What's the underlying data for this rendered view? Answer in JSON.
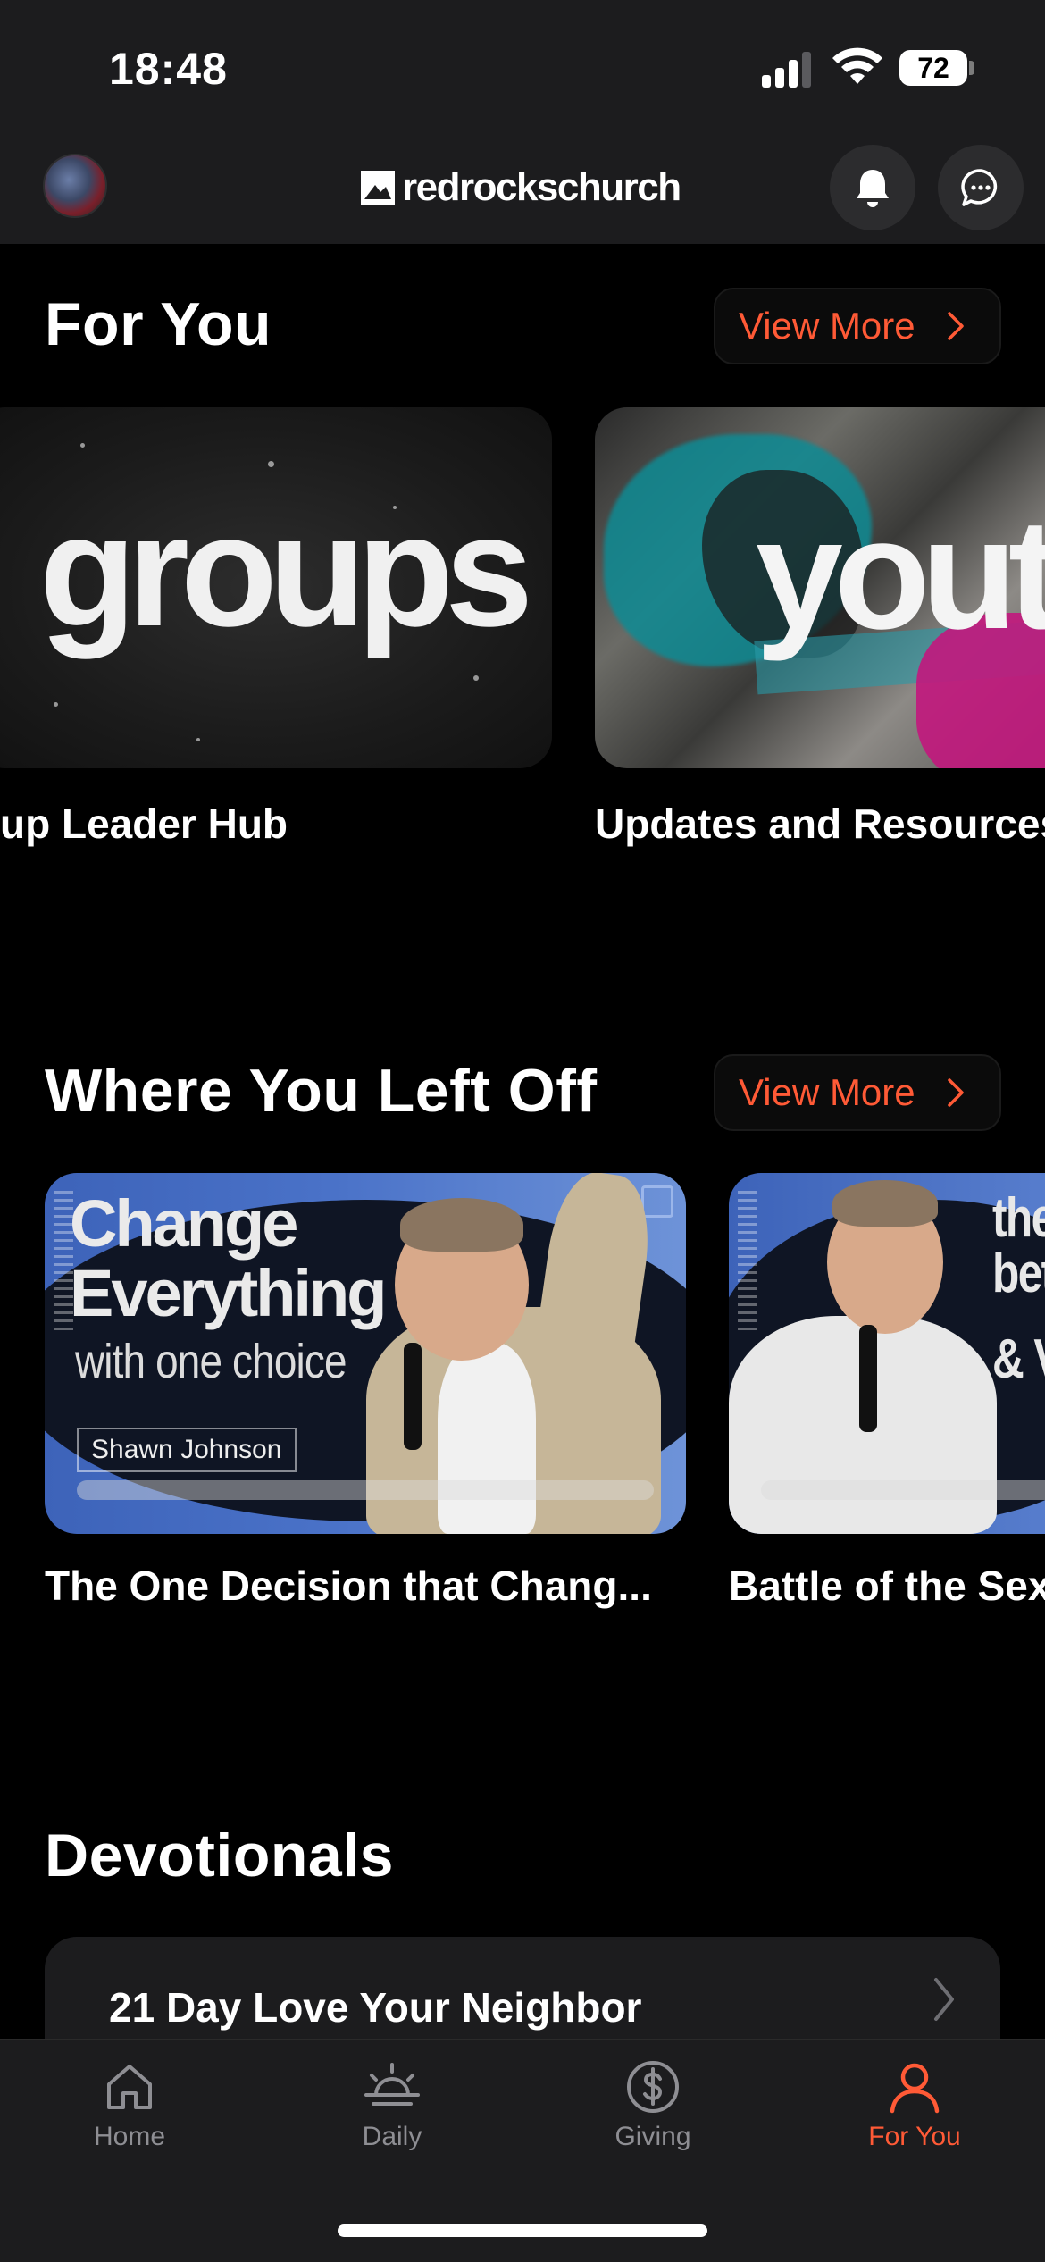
{
  "status_bar": {
    "time": "18:48",
    "battery": "72"
  },
  "header": {
    "logo_text": "redrockschurch"
  },
  "for_you": {
    "title": "For You",
    "view_more": "View More",
    "cards": [
      {
        "art_text": "groups",
        "caption": "up Leader Hub"
      },
      {
        "art_text": "youth",
        "caption": "Updates and Resources"
      }
    ]
  },
  "left_off": {
    "title": "Where You Left Off",
    "view_more": "View More",
    "cards": [
      {
        "art_title_1": "Change",
        "art_title_2": "Everything",
        "art_subtitle": "with one choice",
        "art_speaker": "Shawn Johnson",
        "caption": "The One Decision that Chang..."
      },
      {
        "art_text_1": "the",
        "art_text_2": "bet",
        "art_text_3": "& V",
        "caption": "Battle of the Sex"
      }
    ]
  },
  "devotionals": {
    "title": "Devotionals",
    "items": [
      {
        "label": "21 Day Love Your Neighbor"
      }
    ]
  },
  "tab_bar": {
    "tabs": [
      {
        "label": "Home",
        "icon": "home-icon"
      },
      {
        "label": "Daily",
        "icon": "sunrise-icon"
      },
      {
        "label": "Giving",
        "icon": "dollar-icon"
      },
      {
        "label": "For You",
        "icon": "person-icon",
        "active": true
      }
    ]
  },
  "colors": {
    "accent": "#ff5a36",
    "background": "#000000",
    "surface": "#1c1c1e"
  }
}
